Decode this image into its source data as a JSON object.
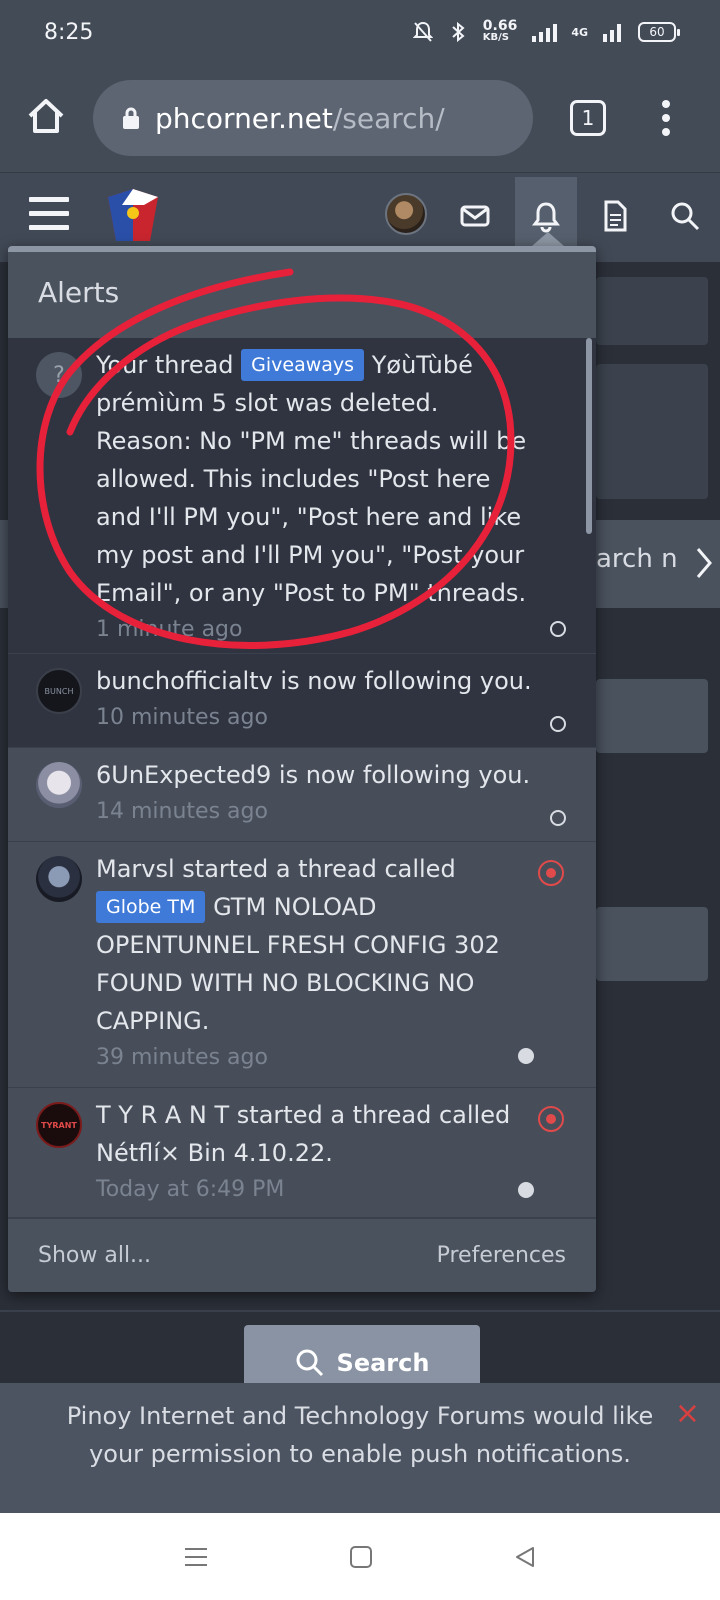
{
  "statusbar": {
    "time": "8:25",
    "network_speed": "0.66",
    "network_unit": "KB/S",
    "network_type": "4G",
    "battery": "60"
  },
  "browser": {
    "url_host": "phcorner.net",
    "url_path": "/search/",
    "tab_count": "1"
  },
  "alerts": {
    "title": "Alerts",
    "items": [
      {
        "pre": "Your thread",
        "tag": "Giveaways",
        "text": "YøùTùbé prémìùm 5 slot was deleted. Reason: No \"PM me\" threads will be allowed. This includes \"Post here and I'll PM you\", \"Post here and like my post and I'll PM you\", \"Post your Email\", or any \"Post to PM\" threads.",
        "time": "1 minute ago"
      },
      {
        "text": "bunchofficialtv is now following you.",
        "time": "10 minutes ago",
        "avatar_text": "BUNCH"
      },
      {
        "text": "6UnExpected9 is now following you.",
        "time": "14 minutes ago"
      },
      {
        "pre": "Marvsl started a thread called",
        "tag": "Globe TM",
        "text": "GTM NOLOAD OPENTUNNEL FRESH CONFIG 302 FOUND WITH NO BLOCKING NO CAPPING.",
        "time": "39 minutes ago"
      },
      {
        "text": "T Y R A N T started a thread called Nétflí× Bin 4.10.22.",
        "time": "Today at 6:49 PM",
        "avatar_text": "TYRANT"
      }
    ],
    "show_all": "Show all...",
    "preferences": "Preferences"
  },
  "background": {
    "partial_text": "arch n"
  },
  "search_button": "Search",
  "push_notice": {
    "text": "Pinoy Internet and Technology Forums would like your permission to enable push notifications.",
    "close": "×"
  },
  "colors": {
    "tag_blue": "#3f7ad8",
    "annotation_red": "#e8213a",
    "unread_bg": "#2f3440",
    "read_bg": "#474e5a"
  }
}
